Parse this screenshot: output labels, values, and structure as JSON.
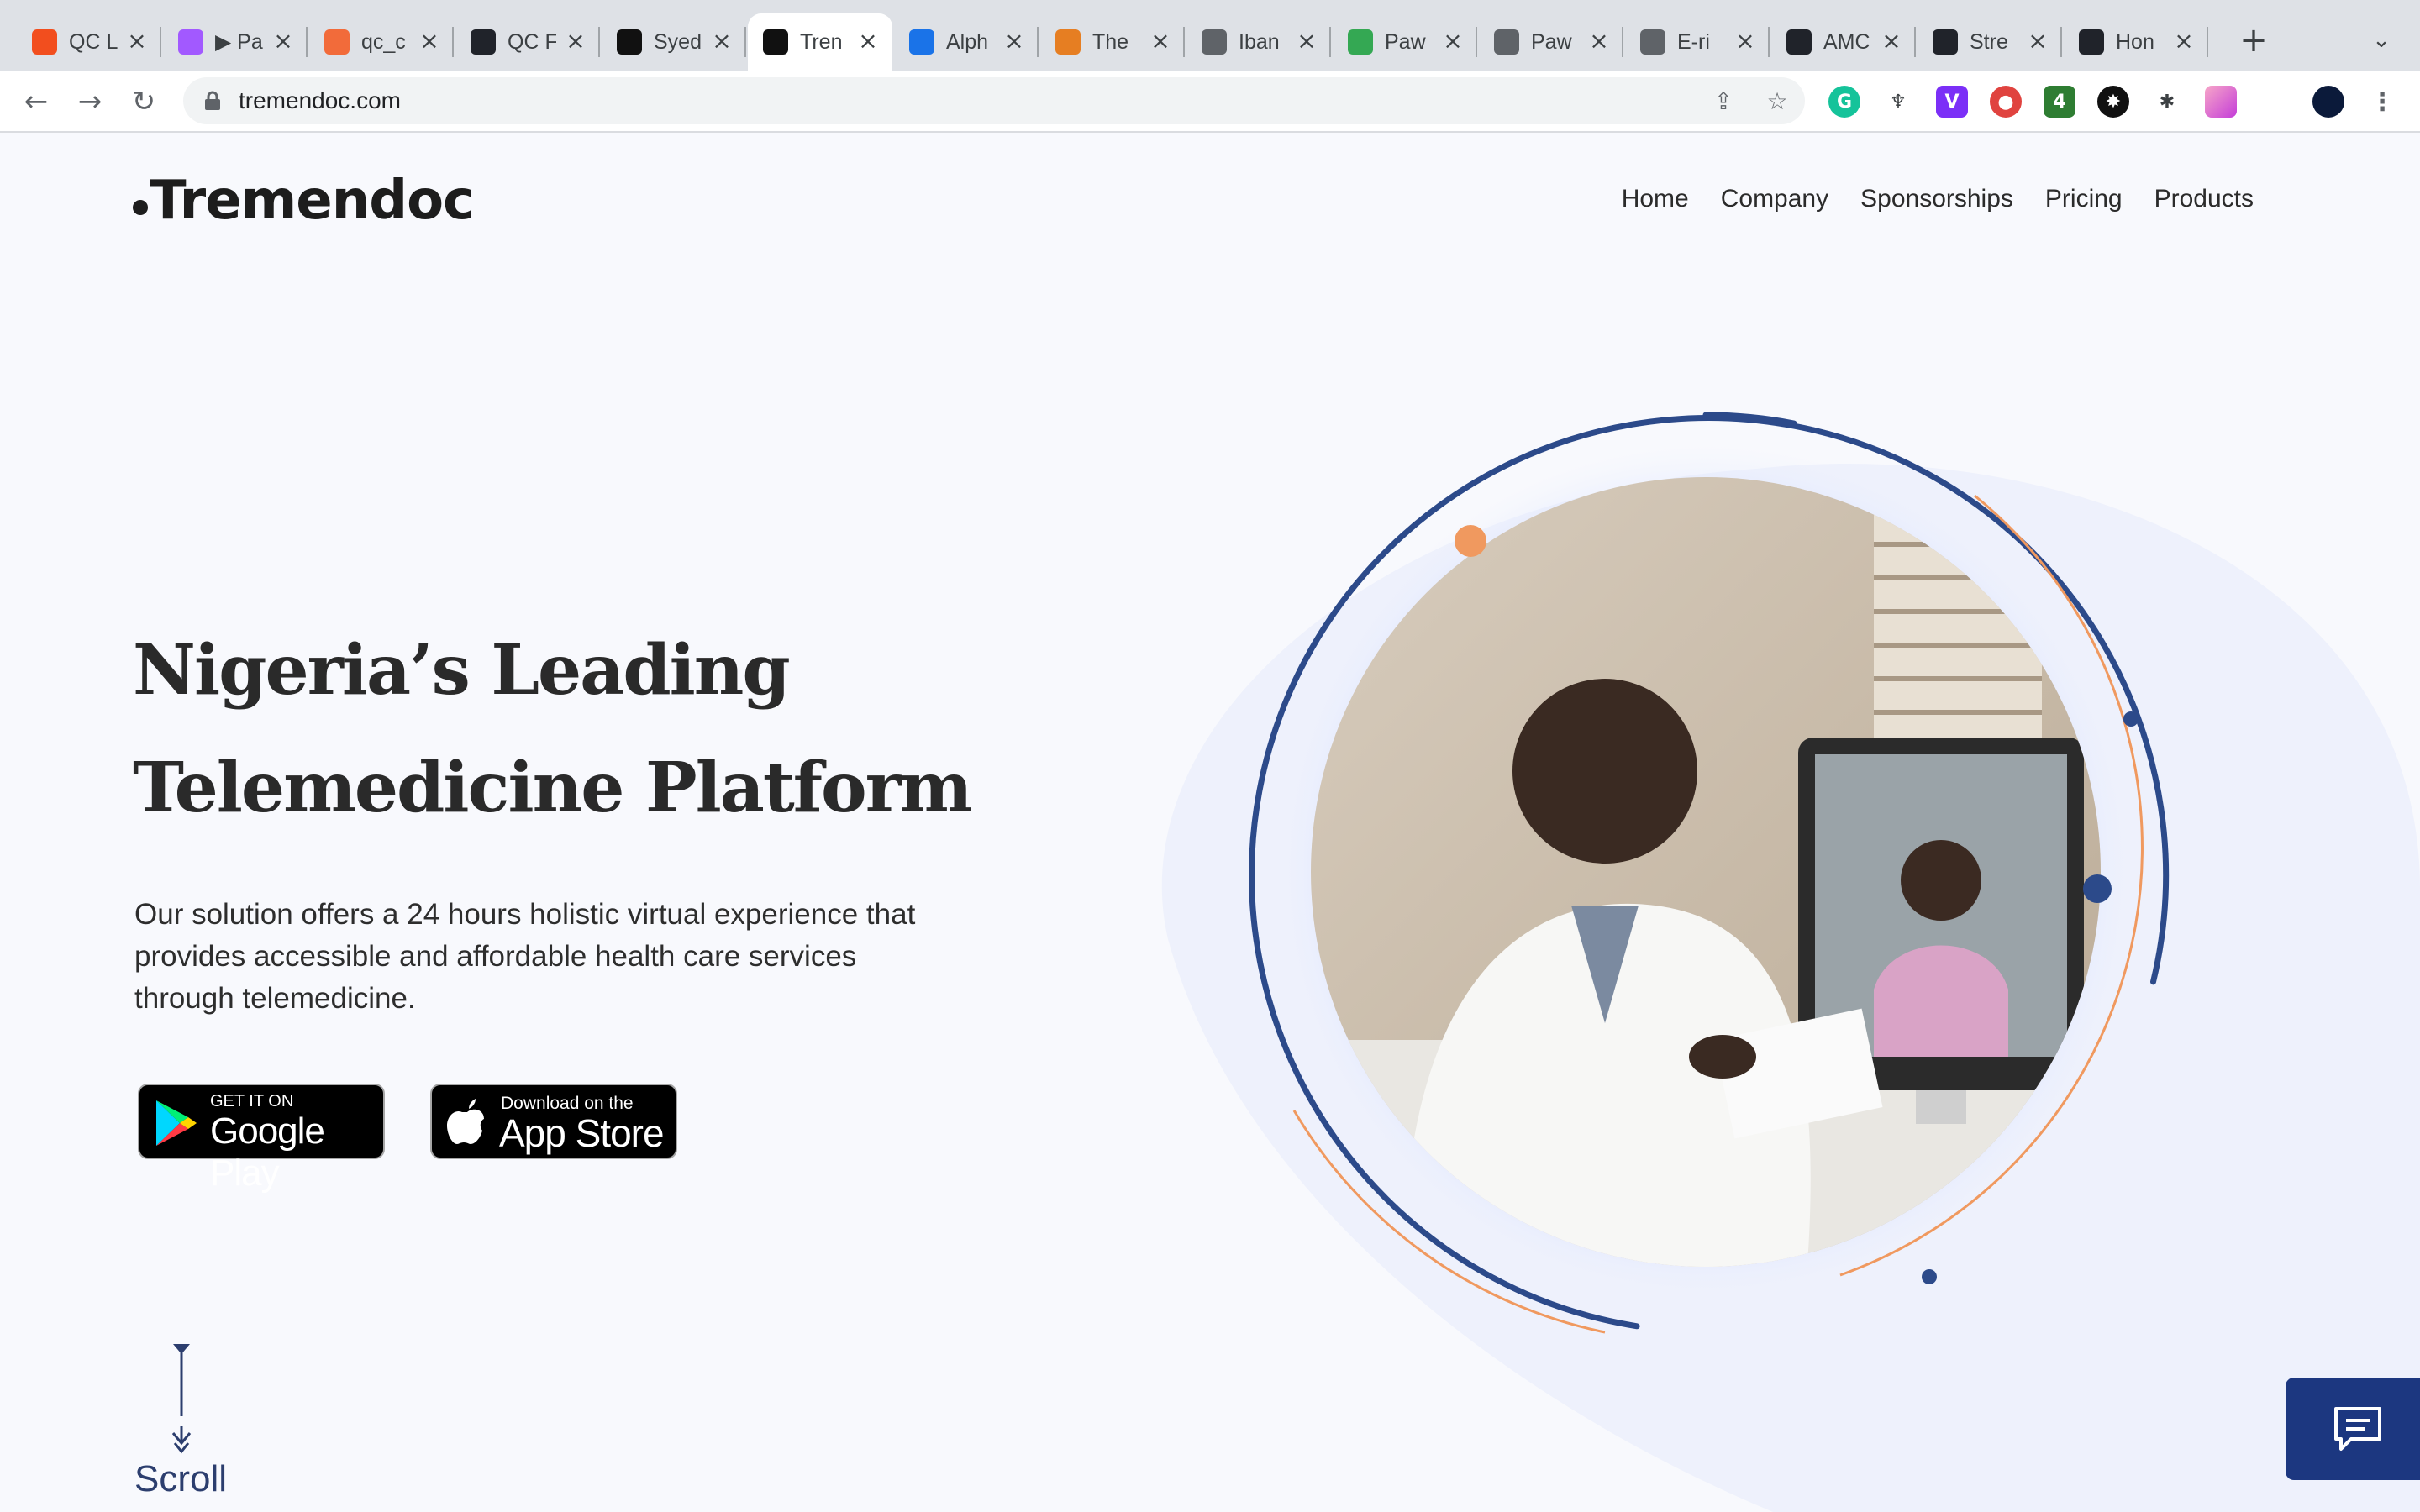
{
  "browser": {
    "tabs": [
      {
        "label": "QC L",
        "icon": "figma-icon",
        "color": "#f24e1e"
      },
      {
        "label": "▶ Pa",
        "icon": "figma-icon",
        "color": "#a259ff"
      },
      {
        "label": "qc_c",
        "icon": "brand-icon",
        "color": "#f26b3a"
      },
      {
        "label": "QC F",
        "icon": "react-icon",
        "color": "#20232a"
      },
      {
        "label": "Syed",
        "icon": "s-icon",
        "color": "#111111"
      },
      {
        "label": "Tren",
        "icon": "tremendoc-icon",
        "color": "#111111",
        "active": true
      },
      {
        "label": "Alph",
        "icon": "alpha-icon",
        "color": "#1a73e8"
      },
      {
        "label": "The",
        "icon": "brand-icon",
        "color": "#e67e22"
      },
      {
        "label": "Iban",
        "icon": "loop-icon",
        "color": "#5f6368"
      },
      {
        "label": "Paw",
        "icon": "play-icon",
        "color": "#34a853"
      },
      {
        "label": "Paw",
        "icon": "globe-icon",
        "color": "#5f6368"
      },
      {
        "label": "E-ri",
        "icon": "globe-icon",
        "color": "#5f6368"
      },
      {
        "label": "AMC",
        "icon": "react-icon",
        "color": "#20232a"
      },
      {
        "label": "Stre",
        "icon": "react-icon",
        "color": "#20232a"
      },
      {
        "label": "Hon",
        "icon": "react-icon",
        "color": "#20232a"
      }
    ],
    "url": "tremendoc.com",
    "extensions": [
      {
        "icon": "grammarly-icon",
        "color": "#15c39a",
        "glyph": "G"
      },
      {
        "icon": "crab-icon",
        "color": "#ffffff",
        "glyph": "♆"
      },
      {
        "icon": "v-icon",
        "color": "#7b2ff7",
        "glyph": "V"
      },
      {
        "icon": "color-wheel-icon",
        "color": "#e0433f",
        "glyph": "●"
      },
      {
        "icon": "badge-icon",
        "color": "#2e7d32",
        "glyph": "4"
      },
      {
        "icon": "flame-icon",
        "color": "#111111",
        "glyph": "✸"
      },
      {
        "icon": "bug-icon",
        "color": "#ffffff",
        "glyph": "✱"
      },
      {
        "icon": "gradient-icon",
        "color": "#e85d9a",
        "glyph": ""
      },
      {
        "icon": "puzzle-icon",
        "color": "#ffffff",
        "glyph": ""
      },
      {
        "icon": "avatar-icon",
        "color": "#0b1a3a",
        "glyph": ""
      }
    ]
  },
  "site": {
    "logo": "Tremendoc",
    "nav": [
      "Home",
      "Company",
      "Sponsorships",
      "Pricing",
      "Products"
    ]
  },
  "hero": {
    "title_line1": "Nigeria’s Leading",
    "title_line2": "Telemedicine Platform",
    "description": "Our solution offers a 24 hours holistic virtual experience that provides accessible and affordable health care services through telemedicine.",
    "google_play": {
      "small": "GET IT ON",
      "big": "Google Play"
    },
    "app_store": {
      "small": "Download on the",
      "big": "App Store"
    },
    "scroll_label": "Scroll",
    "colors": {
      "navy": "#2c4a8a",
      "orange": "#f0995f",
      "accent": "#1c3780"
    }
  }
}
